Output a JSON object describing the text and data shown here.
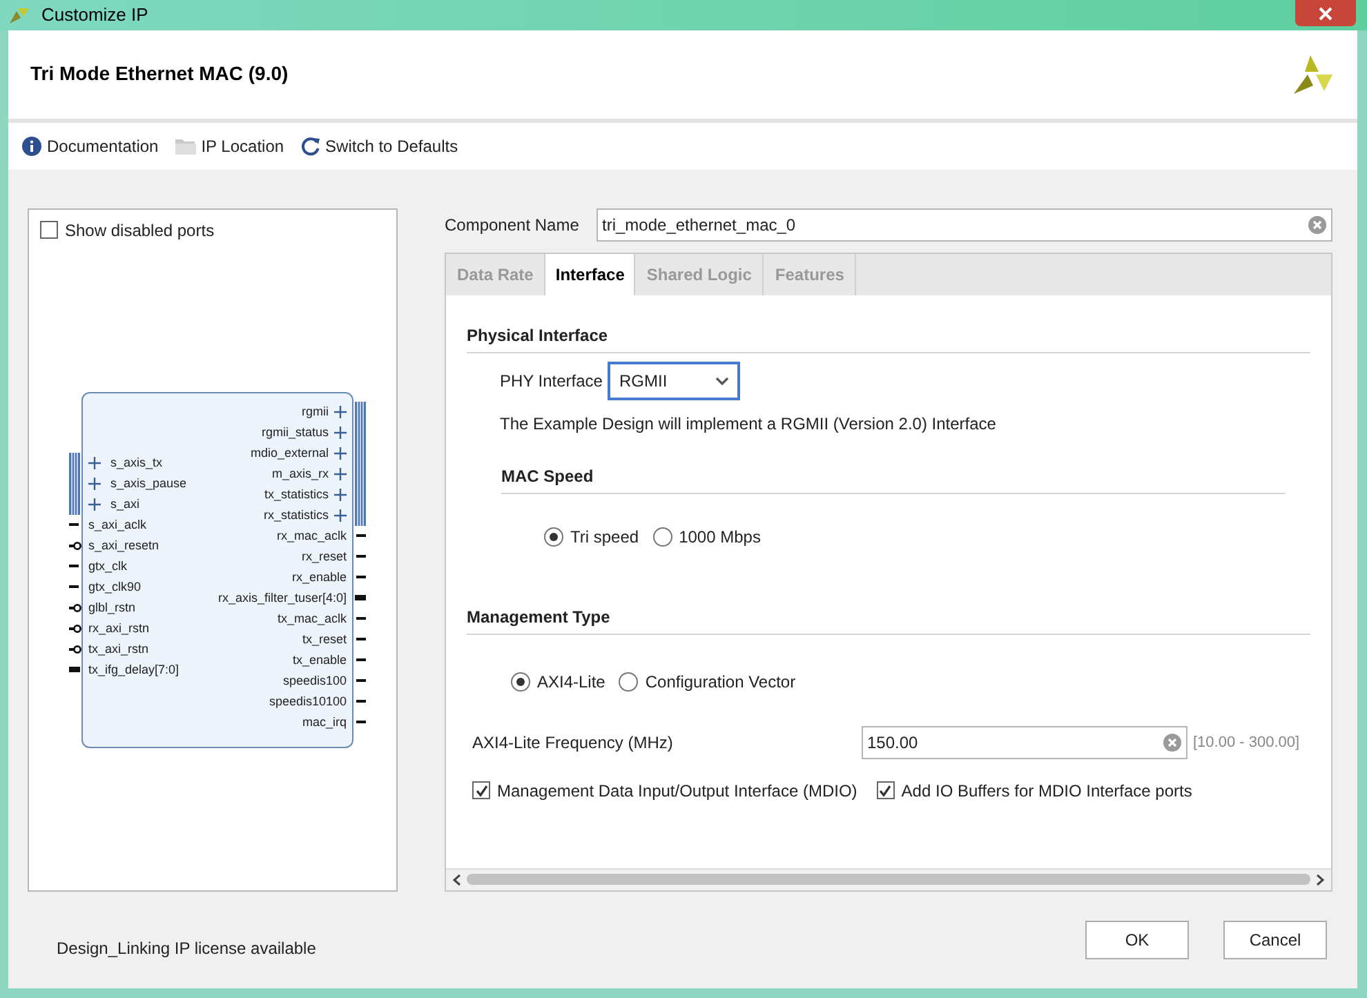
{
  "window": {
    "title": "Customize IP"
  },
  "header": {
    "title": "Tri Mode Ethernet MAC (9.0)"
  },
  "toolbar": [
    {
      "kind": "info",
      "label": "Documentation",
      "disabled": false
    },
    {
      "kind": "folder",
      "label": "IP Location",
      "disabled": false
    },
    {
      "kind": "refresh",
      "label": "Switch to Defaults",
      "disabled": false
    }
  ],
  "ports_panel": {
    "show_disabled": {
      "label": "Show disabled ports",
      "checked": false
    },
    "left_ports": [
      {
        "name": "s_axis_tx",
        "kind": "bus"
      },
      {
        "name": "s_axis_pause",
        "kind": "bus"
      },
      {
        "name": "s_axi",
        "kind": "bus"
      },
      {
        "name": "s_axi_aclk",
        "kind": "wire"
      },
      {
        "name": "s_axi_resetn",
        "kind": "reset"
      },
      {
        "name": "gtx_clk",
        "kind": "wire"
      },
      {
        "name": "gtx_clk90",
        "kind": "wire"
      },
      {
        "name": "glbl_rstn",
        "kind": "reset"
      },
      {
        "name": "rx_axi_rstn",
        "kind": "reset"
      },
      {
        "name": "tx_axi_rstn",
        "kind": "reset"
      },
      {
        "name": "tx_ifg_delay[7:0]",
        "kind": "vector"
      }
    ],
    "right_ports": [
      {
        "name": "rgmii",
        "kind": "bus"
      },
      {
        "name": "rgmii_status",
        "kind": "bus"
      },
      {
        "name": "mdio_external",
        "kind": "bus"
      },
      {
        "name": "m_axis_rx",
        "kind": "bus"
      },
      {
        "name": "tx_statistics",
        "kind": "bus"
      },
      {
        "name": "rx_statistics",
        "kind": "bus"
      },
      {
        "name": "rx_mac_aclk",
        "kind": "wire"
      },
      {
        "name": "rx_reset",
        "kind": "wire"
      },
      {
        "name": "rx_enable",
        "kind": "wire"
      },
      {
        "name": "rx_axis_filter_tuser[4:0]",
        "kind": "vector"
      },
      {
        "name": "tx_mac_aclk",
        "kind": "wire"
      },
      {
        "name": "tx_reset",
        "kind": "wire"
      },
      {
        "name": "tx_enable",
        "kind": "wire"
      },
      {
        "name": "speedis100",
        "kind": "wire"
      },
      {
        "name": "speedis10100",
        "kind": "wire"
      },
      {
        "name": "mac_irq",
        "kind": "wire"
      }
    ]
  },
  "component_name": {
    "label": "Component Name",
    "value": "tri_mode_ethernet_mac_0"
  },
  "tabs": [
    {
      "label": "Data Rate",
      "selected": false
    },
    {
      "label": "Interface",
      "selected": true
    },
    {
      "label": "Shared Logic",
      "selected": false
    },
    {
      "label": "Features",
      "selected": false
    }
  ],
  "physical_interface": {
    "heading": "Physical Interface",
    "phy_label": "PHY Interface",
    "phy_value": "RGMII",
    "note": "The Example Design will implement a RGMII (Version 2.0) Interface",
    "mac_speed": {
      "heading": "MAC Speed",
      "options": [
        {
          "label": "Tri speed",
          "selected": true
        },
        {
          "label": "1000 Mbps",
          "selected": false
        }
      ]
    }
  },
  "management_type": {
    "heading": "Management Type",
    "options": [
      {
        "label": "AXI4-Lite",
        "selected": true
      },
      {
        "label": "Configuration Vector",
        "selected": false
      }
    ],
    "frequency": {
      "label": "AXI4-Lite Frequency (MHz)",
      "value": "150.00",
      "range": "[10.00 - 300.00]"
    },
    "checkboxes": [
      {
        "label": "Management Data Input/Output Interface (MDIO)",
        "checked": true
      },
      {
        "label": "Add IO Buffers for MDIO Interface ports",
        "checked": true
      }
    ]
  },
  "footer": {
    "license": "Design_Linking IP license available",
    "buttons": [
      "OK",
      "Cancel"
    ]
  }
}
